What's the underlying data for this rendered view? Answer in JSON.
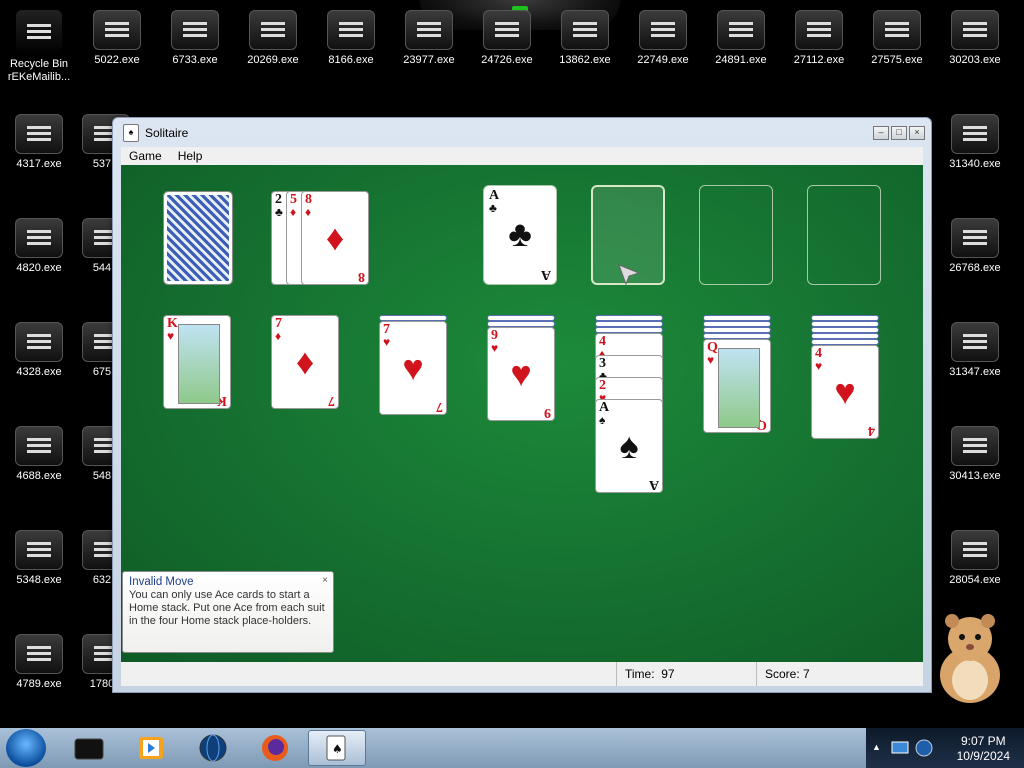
{
  "desktop": {
    "icons_top": [
      "Recycle Bin",
      "5022.exe",
      "6733.exe",
      "20269.exe",
      "8166.exe",
      "23977.exe",
      "24726.exe",
      "13862.exe",
      "22749.exe",
      "24891.exe",
      "27112.exe",
      "27575.exe",
      "30203.exe"
    ],
    "recycle_sub": "rEKeMailib...",
    "icons_left": [
      "4317.exe",
      "4820.exe",
      "4328.exe",
      "4688.exe",
      "5348.exe",
      "4789.exe"
    ],
    "icons_left2": [
      "537",
      "544",
      "675",
      "548",
      "632",
      "1780"
    ],
    "icons_right": [
      "31340.exe",
      "26768.exe",
      "31347.exe",
      "30413.exe",
      "28054.exe"
    ]
  },
  "window": {
    "title": "Solitaire",
    "menu": [
      "Game",
      "Help"
    ],
    "status": {
      "time_label": "Time:",
      "time_value": "97",
      "score_label": "Score:",
      "score_value": "7"
    }
  },
  "tooltip": {
    "title": "Invalid Move",
    "body": "You can only use Ace cards to start a Home stack. Put one Ace from each suit in the four Home stack place-holders.",
    "close": "×"
  },
  "cards": {
    "waste": [
      {
        "rank": "2",
        "suit": "♣",
        "color": "blk"
      },
      {
        "rank": "5",
        "suit": "♦",
        "color": "red"
      },
      {
        "rank": "8",
        "suit": "♦",
        "color": "red"
      }
    ],
    "foundation1": {
      "rank": "A",
      "suit": "♣",
      "color": "blk"
    },
    "tableau": [
      [
        {
          "rank": "K",
          "suit": "♥",
          "color": "red",
          "face": true
        }
      ],
      [
        {
          "rank": "7",
          "suit": "♦",
          "color": "red"
        }
      ],
      [
        {
          "rank": "7",
          "suit": "♥",
          "color": "red"
        }
      ],
      [
        {
          "rank": "9",
          "suit": "♥",
          "color": "red"
        }
      ],
      [
        {
          "rank": "4",
          "suit": "♦",
          "color": "red"
        },
        {
          "rank": "3",
          "suit": "♣",
          "color": "blk"
        },
        {
          "rank": "2",
          "suit": "♥",
          "color": "red"
        },
        {
          "rank": "A",
          "suit": "♠",
          "color": "blk"
        }
      ],
      [
        {
          "rank": "Q",
          "suit": "♥",
          "color": "red",
          "face": true
        }
      ],
      [
        {
          "rank": "4",
          "suit": "♥",
          "color": "red"
        }
      ]
    ]
  },
  "taskbar": {
    "apps": [
      "desktop-app-icon",
      "media-player-icon",
      "network-globe-icon",
      "firefox-icon",
      "solitaire-icon"
    ],
    "clock_time": "9:07 PM",
    "clock_date": "10/9/2024"
  }
}
